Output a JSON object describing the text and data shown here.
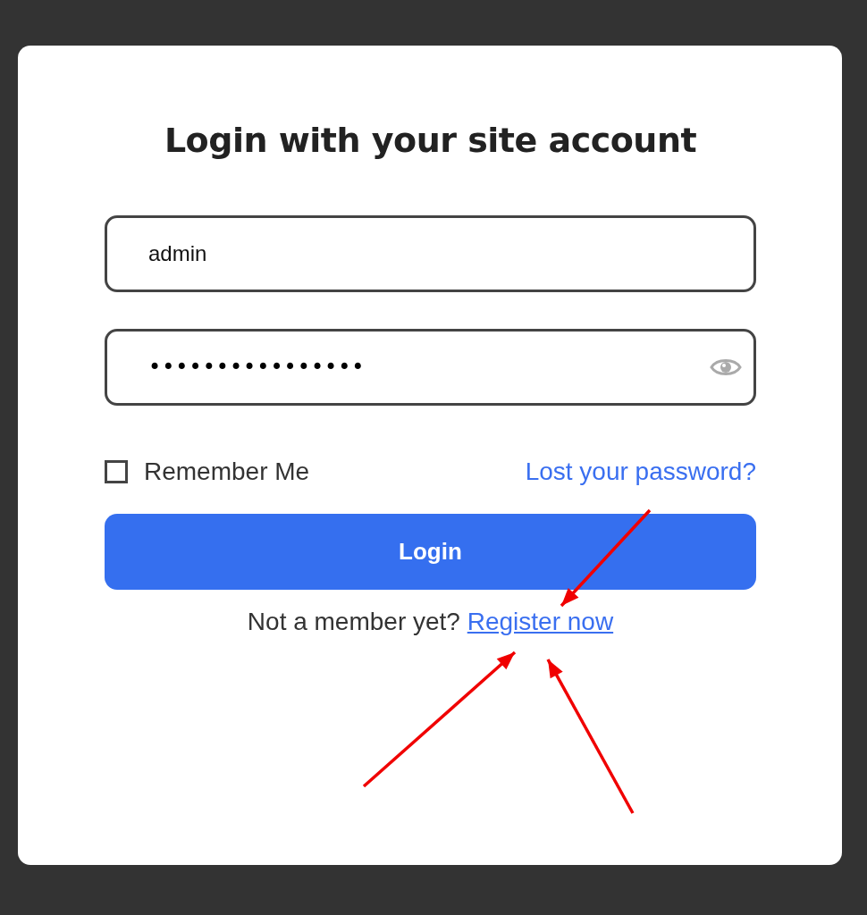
{
  "title": "Login with your site account",
  "username": {
    "value": "admin"
  },
  "password": {
    "value": "••••••••••••••••"
  },
  "remember": {
    "label": "Remember Me",
    "checked": false
  },
  "lost_password": "Lost your password?",
  "login_button": "Login",
  "register": {
    "prompt": "Not a member yet?",
    "link": "Register now"
  },
  "annotations": [
    {
      "kind": "arrow"
    },
    {
      "kind": "arrow"
    },
    {
      "kind": "arrow"
    }
  ]
}
